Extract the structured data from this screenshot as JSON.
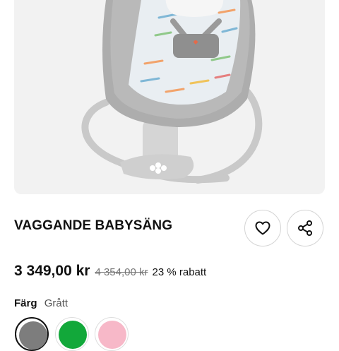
{
  "product": {
    "title": "VAGGANDE BABYSÄNG",
    "price": "3 349,00 kr",
    "old_price": "4 354,00 kr",
    "discount": "23 % rabatt",
    "color_label": "Färg",
    "color_value": "Grått",
    "swatches": [
      {
        "name": "grey",
        "color": "#7d7d7d",
        "selected": true
      },
      {
        "name": "green",
        "color": "#12a83a",
        "selected": false
      },
      {
        "name": "pink",
        "color": "#f7b8c8",
        "selected": false
      }
    ]
  },
  "icons": {
    "favorite": "heart-icon",
    "share": "share-icon"
  }
}
